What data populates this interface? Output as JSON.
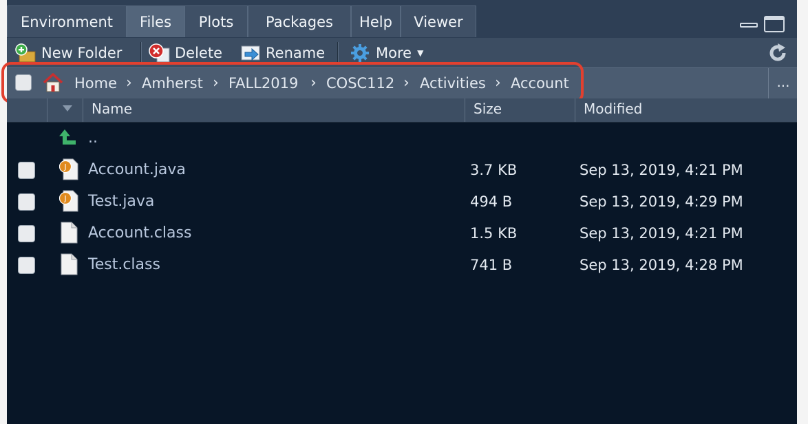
{
  "tabs": [
    "Environment",
    "Files",
    "Plots",
    "Packages",
    "Help",
    "Viewer"
  ],
  "active_tab": "Files",
  "toolbar": {
    "new_folder": "New Folder",
    "delete": "Delete",
    "rename": "Rename",
    "more": "More"
  },
  "breadcrumb": [
    "Home",
    "Amherst",
    "FALL2019",
    "COSC112",
    "Activities",
    "Account"
  ],
  "breadcrumb_more": "...",
  "columns": {
    "name": "Name",
    "size": "Size",
    "modified": "Modified"
  },
  "parent_dir": "..",
  "files": [
    {
      "name": "Account.java",
      "size": "3.7 KB",
      "modified": "Sep 13, 2019, 4:21 PM",
      "icon": "java-file-icon"
    },
    {
      "name": "Test.java",
      "size": "494 B",
      "modified": "Sep 13, 2019, 4:29 PM",
      "icon": "java-file-icon"
    },
    {
      "name": "Account.class",
      "size": "1.5 KB",
      "modified": "Sep 13, 2019, 4:21 PM",
      "icon": "file-icon"
    },
    {
      "name": "Test.class",
      "size": "741 B",
      "modified": "Sep 13, 2019, 4:28 PM",
      "icon": "file-icon"
    }
  ],
  "colors": {
    "highlight": "#e2402f",
    "pane_bg": "#081627",
    "link": "#b9c8de"
  }
}
